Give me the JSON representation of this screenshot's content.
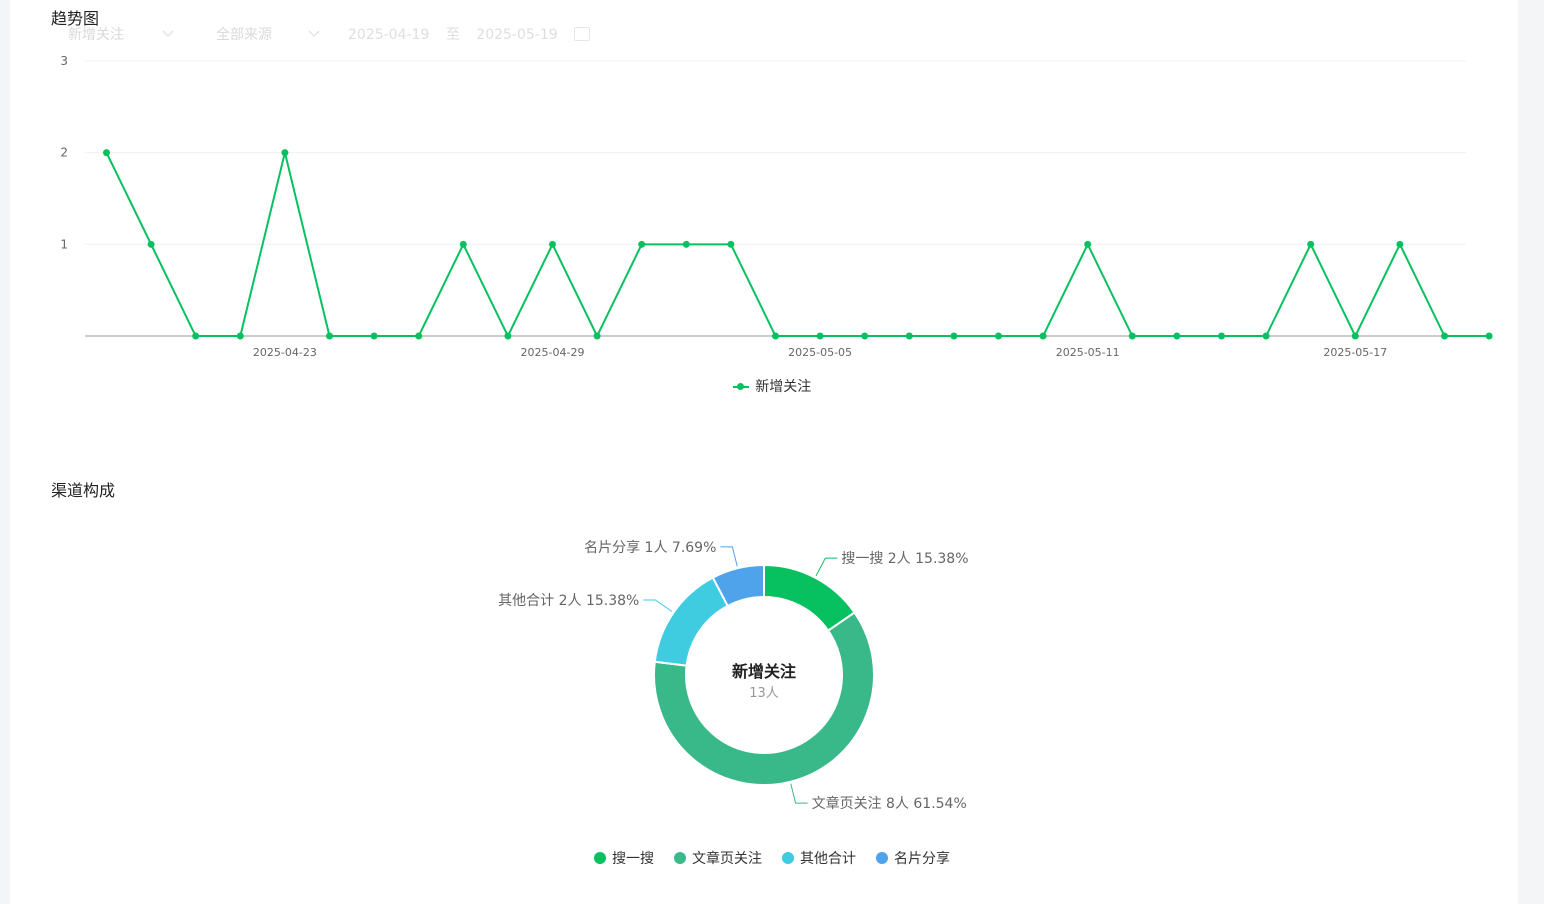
{
  "trend": {
    "title": "趋势图",
    "filter_metric": "新增关注",
    "filter_source": "全部来源",
    "date_start": "2025-04-19",
    "date_sep": "至",
    "date_end": "2025-05-19"
  },
  "channels": {
    "title": "渠道构成"
  },
  "colors": {
    "line": "#07c160",
    "search": "#07c160",
    "article": "#39b88a",
    "other": "#3fcbe0",
    "card": "#4fa3ea"
  },
  "chart_data": [
    {
      "type": "line",
      "x": [
        "2025-04-19",
        "2025-04-20",
        "2025-04-21",
        "2025-04-22",
        "2025-04-23",
        "2025-04-24",
        "2025-04-25",
        "2025-04-26",
        "2025-04-27",
        "2025-04-28",
        "2025-04-29",
        "2025-04-30",
        "2025-05-01",
        "2025-05-02",
        "2025-05-03",
        "2025-05-04",
        "2025-05-05",
        "2025-05-06",
        "2025-05-07",
        "2025-05-08",
        "2025-05-09",
        "2025-05-10",
        "2025-05-11",
        "2025-05-12",
        "2025-05-13",
        "2025-05-14",
        "2025-05-15",
        "2025-05-16",
        "2025-05-17",
        "2025-05-18",
        "2025-05-19",
        "2025-05-20"
      ],
      "xticks": [
        "2025-04-23",
        "2025-04-29",
        "2025-05-05",
        "2025-05-11",
        "2025-05-17"
      ],
      "yticks": [
        1,
        2,
        3
      ],
      "ylim": [
        0,
        3
      ],
      "series": [
        {
          "name": "新增关注",
          "values": [
            2,
            1,
            0,
            0,
            2,
            0,
            0,
            0,
            1,
            0,
            1,
            0,
            1,
            1,
            1,
            0,
            0,
            0,
            0,
            0,
            0,
            0,
            1,
            0,
            0,
            0,
            0,
            1,
            0,
            1,
            0,
            0
          ]
        }
      ],
      "legend": "bottom-center"
    },
    {
      "type": "pie",
      "center_title": "新增关注",
      "center_value": "13人",
      "slices": [
        {
          "name": "搜一搜",
          "count": 2,
          "value_label": "2人",
          "percent": 15.38,
          "percent_label": "15.38%",
          "color": "#07c160"
        },
        {
          "name": "文章页关注",
          "count": 8,
          "value_label": "8人",
          "percent": 61.54,
          "percent_label": "61.54%",
          "color": "#39b88a"
        },
        {
          "name": "其他合计",
          "count": 2,
          "value_label": "2人",
          "percent": 15.38,
          "percent_label": "15.38%",
          "color": "#3fcbe0"
        },
        {
          "name": "名片分享",
          "count": 1,
          "value_label": "1人",
          "percent": 7.69,
          "percent_label": "7.69%",
          "color": "#4fa3ea"
        }
      ],
      "legend": "bottom-center"
    }
  ]
}
